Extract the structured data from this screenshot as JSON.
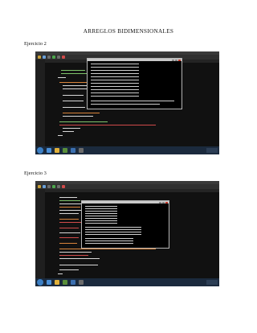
{
  "document": {
    "title": "ARREGLOS BIDIMENSIONALES",
    "sections": [
      {
        "heading": "Ejercicio 2",
        "screenshot": "screenshot-ejercicio-2"
      },
      {
        "heading": "Ejercicio 3",
        "screenshot": "screenshot-ejercicio-3"
      }
    ]
  },
  "colors": {
    "ide_background": "#2b2b2b",
    "editor_background": "#111111",
    "console_background": "#000000",
    "taskbar": "#1b2a3d",
    "code_green": "#7ec36b",
    "code_orange": "#d9843b",
    "code_red": "#d04a4a",
    "code_white": "#d8d8d8"
  }
}
